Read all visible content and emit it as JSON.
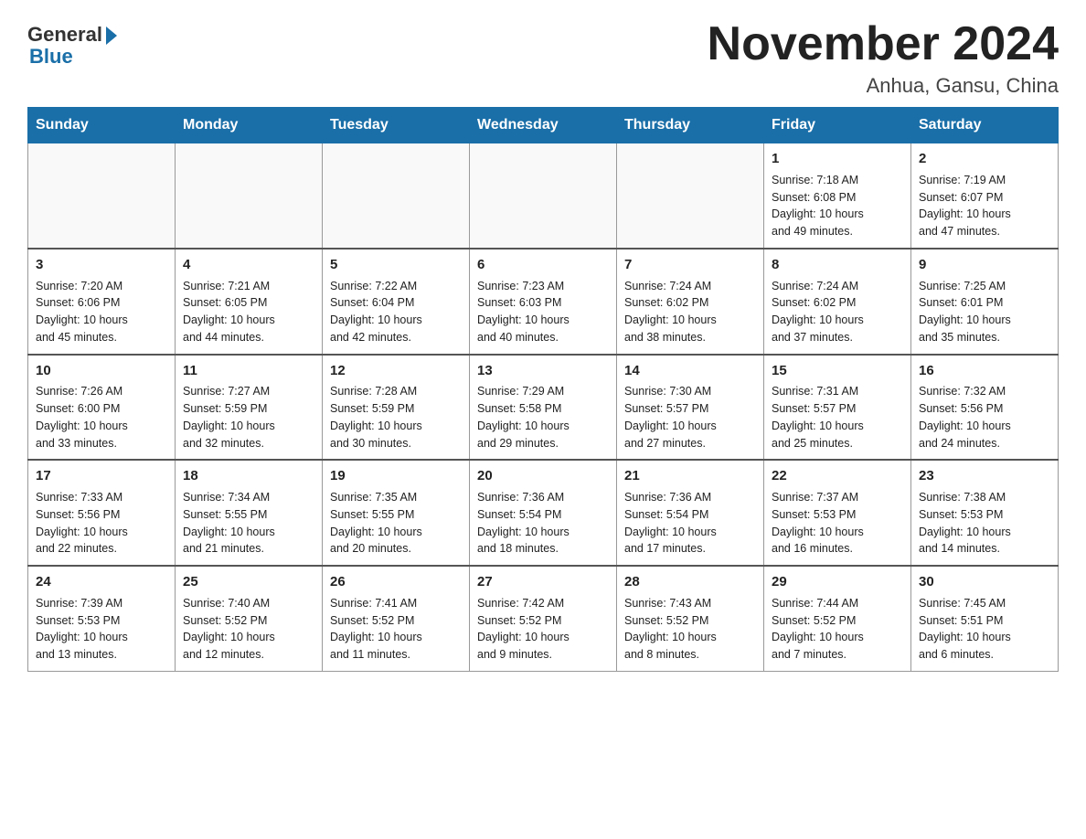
{
  "header": {
    "logo_general": "General",
    "logo_blue": "Blue",
    "month_title": "November 2024",
    "location": "Anhua, Gansu, China"
  },
  "weekdays": [
    "Sunday",
    "Monday",
    "Tuesday",
    "Wednesday",
    "Thursday",
    "Friday",
    "Saturday"
  ],
  "weeks": [
    [
      {
        "day": "",
        "info": ""
      },
      {
        "day": "",
        "info": ""
      },
      {
        "day": "",
        "info": ""
      },
      {
        "day": "",
        "info": ""
      },
      {
        "day": "",
        "info": ""
      },
      {
        "day": "1",
        "info": "Sunrise: 7:18 AM\nSunset: 6:08 PM\nDaylight: 10 hours\nand 49 minutes."
      },
      {
        "day": "2",
        "info": "Sunrise: 7:19 AM\nSunset: 6:07 PM\nDaylight: 10 hours\nand 47 minutes."
      }
    ],
    [
      {
        "day": "3",
        "info": "Sunrise: 7:20 AM\nSunset: 6:06 PM\nDaylight: 10 hours\nand 45 minutes."
      },
      {
        "day": "4",
        "info": "Sunrise: 7:21 AM\nSunset: 6:05 PM\nDaylight: 10 hours\nand 44 minutes."
      },
      {
        "day": "5",
        "info": "Sunrise: 7:22 AM\nSunset: 6:04 PM\nDaylight: 10 hours\nand 42 minutes."
      },
      {
        "day": "6",
        "info": "Sunrise: 7:23 AM\nSunset: 6:03 PM\nDaylight: 10 hours\nand 40 minutes."
      },
      {
        "day": "7",
        "info": "Sunrise: 7:24 AM\nSunset: 6:02 PM\nDaylight: 10 hours\nand 38 minutes."
      },
      {
        "day": "8",
        "info": "Sunrise: 7:24 AM\nSunset: 6:02 PM\nDaylight: 10 hours\nand 37 minutes."
      },
      {
        "day": "9",
        "info": "Sunrise: 7:25 AM\nSunset: 6:01 PM\nDaylight: 10 hours\nand 35 minutes."
      }
    ],
    [
      {
        "day": "10",
        "info": "Sunrise: 7:26 AM\nSunset: 6:00 PM\nDaylight: 10 hours\nand 33 minutes."
      },
      {
        "day": "11",
        "info": "Sunrise: 7:27 AM\nSunset: 5:59 PM\nDaylight: 10 hours\nand 32 minutes."
      },
      {
        "day": "12",
        "info": "Sunrise: 7:28 AM\nSunset: 5:59 PM\nDaylight: 10 hours\nand 30 minutes."
      },
      {
        "day": "13",
        "info": "Sunrise: 7:29 AM\nSunset: 5:58 PM\nDaylight: 10 hours\nand 29 minutes."
      },
      {
        "day": "14",
        "info": "Sunrise: 7:30 AM\nSunset: 5:57 PM\nDaylight: 10 hours\nand 27 minutes."
      },
      {
        "day": "15",
        "info": "Sunrise: 7:31 AM\nSunset: 5:57 PM\nDaylight: 10 hours\nand 25 minutes."
      },
      {
        "day": "16",
        "info": "Sunrise: 7:32 AM\nSunset: 5:56 PM\nDaylight: 10 hours\nand 24 minutes."
      }
    ],
    [
      {
        "day": "17",
        "info": "Sunrise: 7:33 AM\nSunset: 5:56 PM\nDaylight: 10 hours\nand 22 minutes."
      },
      {
        "day": "18",
        "info": "Sunrise: 7:34 AM\nSunset: 5:55 PM\nDaylight: 10 hours\nand 21 minutes."
      },
      {
        "day": "19",
        "info": "Sunrise: 7:35 AM\nSunset: 5:55 PM\nDaylight: 10 hours\nand 20 minutes."
      },
      {
        "day": "20",
        "info": "Sunrise: 7:36 AM\nSunset: 5:54 PM\nDaylight: 10 hours\nand 18 minutes."
      },
      {
        "day": "21",
        "info": "Sunrise: 7:36 AM\nSunset: 5:54 PM\nDaylight: 10 hours\nand 17 minutes."
      },
      {
        "day": "22",
        "info": "Sunrise: 7:37 AM\nSunset: 5:53 PM\nDaylight: 10 hours\nand 16 minutes."
      },
      {
        "day": "23",
        "info": "Sunrise: 7:38 AM\nSunset: 5:53 PM\nDaylight: 10 hours\nand 14 minutes."
      }
    ],
    [
      {
        "day": "24",
        "info": "Sunrise: 7:39 AM\nSunset: 5:53 PM\nDaylight: 10 hours\nand 13 minutes."
      },
      {
        "day": "25",
        "info": "Sunrise: 7:40 AM\nSunset: 5:52 PM\nDaylight: 10 hours\nand 12 minutes."
      },
      {
        "day": "26",
        "info": "Sunrise: 7:41 AM\nSunset: 5:52 PM\nDaylight: 10 hours\nand 11 minutes."
      },
      {
        "day": "27",
        "info": "Sunrise: 7:42 AM\nSunset: 5:52 PM\nDaylight: 10 hours\nand 9 minutes."
      },
      {
        "day": "28",
        "info": "Sunrise: 7:43 AM\nSunset: 5:52 PM\nDaylight: 10 hours\nand 8 minutes."
      },
      {
        "day": "29",
        "info": "Sunrise: 7:44 AM\nSunset: 5:52 PM\nDaylight: 10 hours\nand 7 minutes."
      },
      {
        "day": "30",
        "info": "Sunrise: 7:45 AM\nSunset: 5:51 PM\nDaylight: 10 hours\nand 6 minutes."
      }
    ]
  ]
}
